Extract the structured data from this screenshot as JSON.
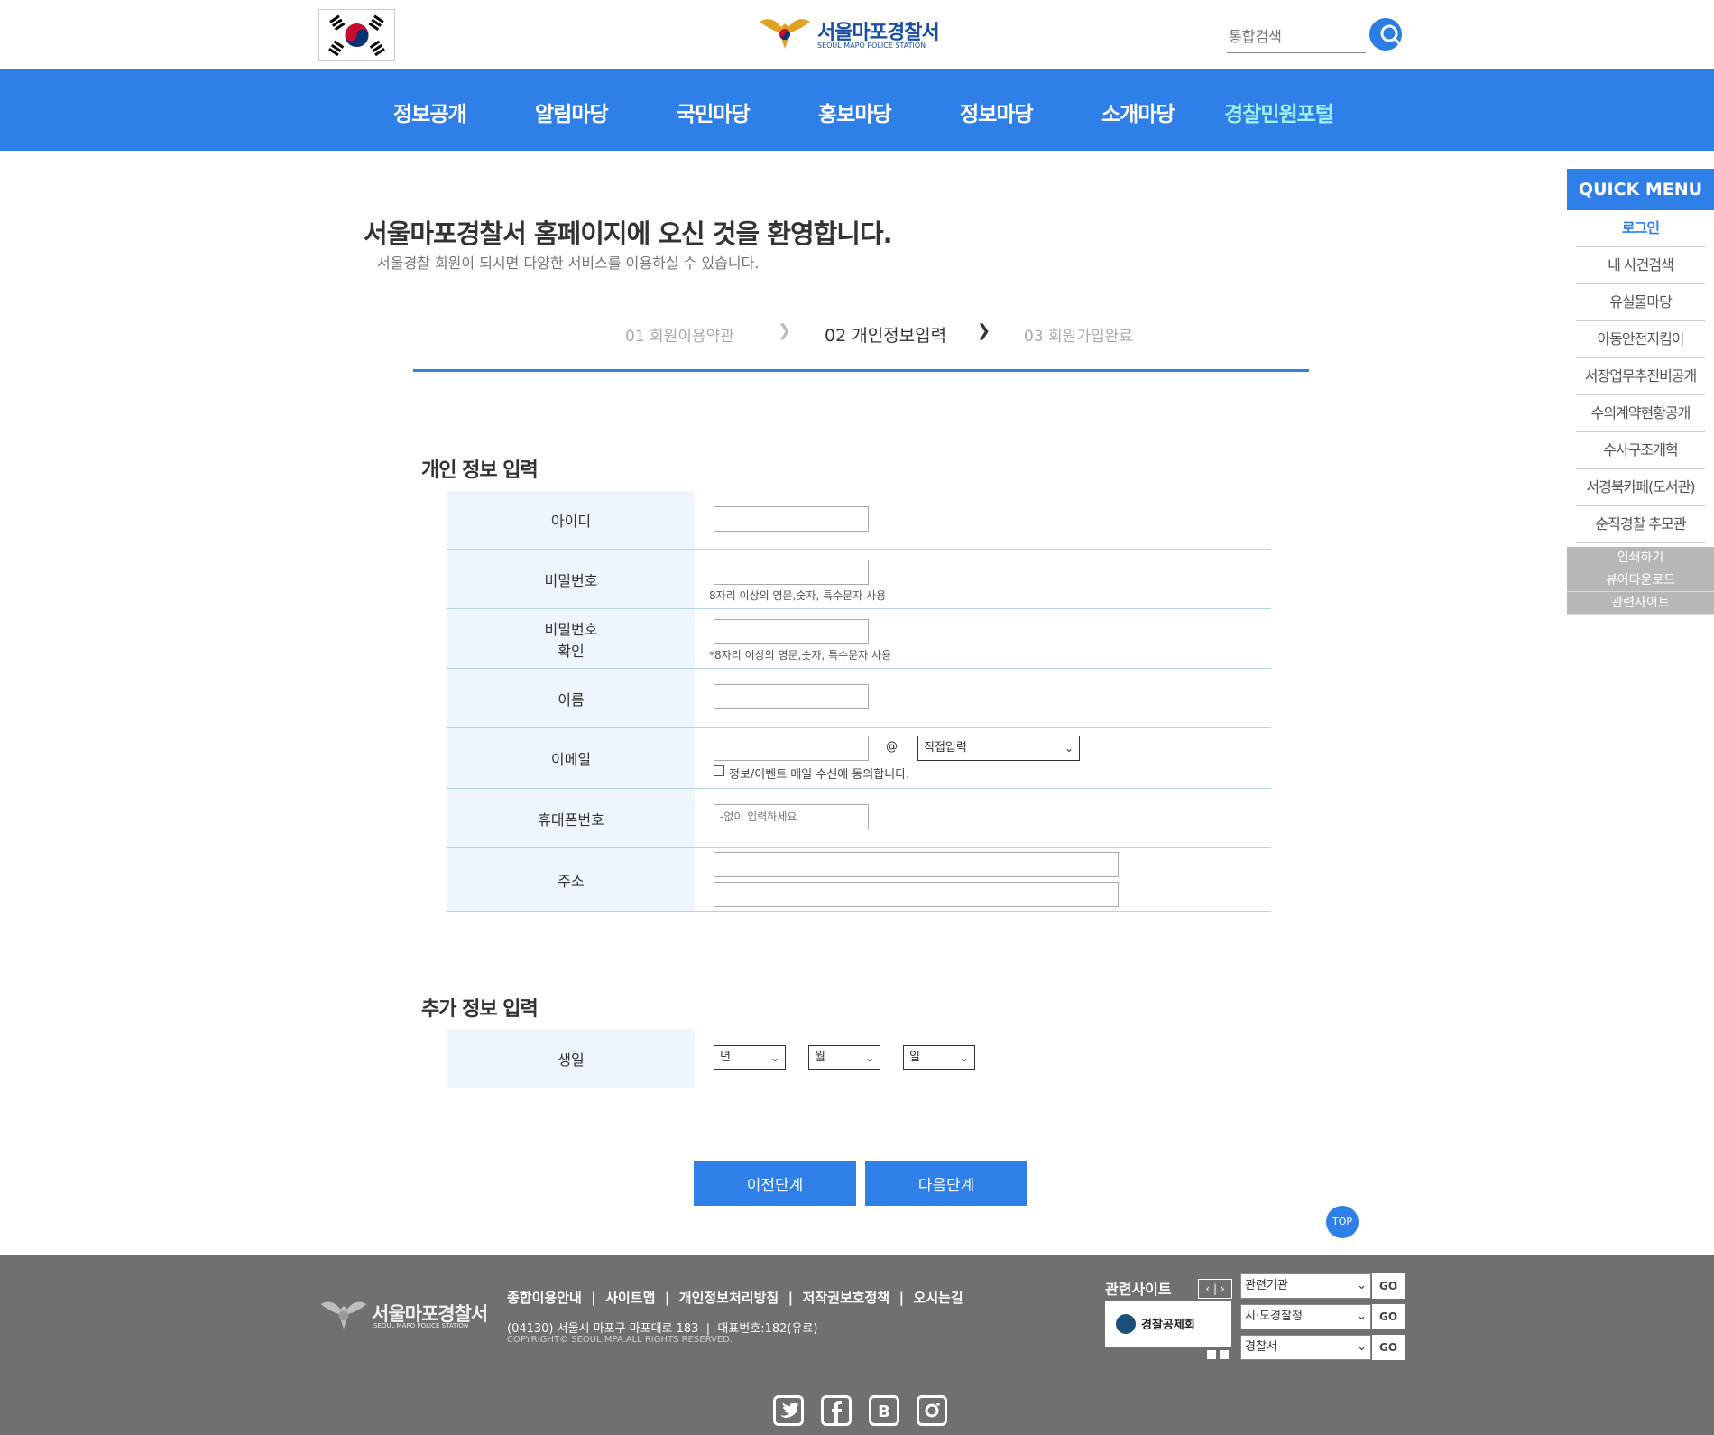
{
  "header": {
    "logo_title": "서울마포경찰서",
    "logo_subtitle": "SEOUL MAPO POLICE STATION",
    "search_placeholder": "통합검색"
  },
  "nav": [
    "정보공개",
    "알림마당",
    "국민마당",
    "홍보마당",
    "정보마당",
    "소개마당",
    "경찰민원포털"
  ],
  "quick_menu": {
    "title": "QUICK MENU",
    "items": [
      "로그인",
      "내 사건검색",
      "유실물마당",
      "아동안전지킴이",
      "서장업무추진비공개",
      "수의계약현황공개",
      "수사구조개혁",
      "서경북카페(도서관)",
      "순직경찰 추모관"
    ],
    "extras": [
      "인쇄하기",
      "뷰어다운로드",
      "관련사이트"
    ]
  },
  "welcome": {
    "title": "서울마포경찰서 홈페이지에 오신 것을 환영합니다.",
    "subtitle": "서울경찰 회원이 되시면 다양한 서비스를 이용하실 수 있습니다."
  },
  "steps": [
    "01 회원이용약관",
    "02 개인정보입력",
    "03 회원가입완료"
  ],
  "personal": {
    "title": "개인 정보 입력",
    "id_label": "아이디",
    "pw_label": "비밀번호",
    "pw_hint": "8자리 이상의 영문,숫자, 특수문자 사용",
    "pw_confirm_label_1": "비밀번호",
    "pw_confirm_label_2": "확인",
    "pw_confirm_hint": "*8자리 이상의 영문,숫자, 특수문자 사용",
    "name_label": "이름",
    "email_label": "이메일",
    "email_at": "@",
    "email_domain_select": "직접입력",
    "email_agree": "정보/이벤트 메일 수신에 동의합니다.",
    "phone_label": "휴대폰번호",
    "phone_placeholder": "-없이 입력하세요",
    "address_label": "주소"
  },
  "extra": {
    "title": "추가 정보 입력",
    "birthday_label": "생일",
    "year": "년",
    "month": "월",
    "day": "일"
  },
  "buttons": {
    "prev": "이전단계",
    "next": "다음단계",
    "top": "TOP"
  },
  "footer": {
    "logo_title": "서울마포경찰서",
    "logo_subtitle": "SEOUL MAPO POLICE STATION",
    "links": [
      "종합이용안내",
      "사이트맵",
      "개인정보처리방침",
      "저작권보호정책",
      "오시는길"
    ],
    "address": "(04130) 서울시 마포구 마포대로 183  |  대표번호:182(유료)",
    "copyright": "COPYRIGHT© SEOUL MPA.ALL RIGHTS RESERVED.",
    "related_title": "관련사이트",
    "banner": "경찰공제회",
    "selects": [
      "관련기관",
      "시·도경찰청",
      "경찰서"
    ],
    "go": "GO"
  }
}
